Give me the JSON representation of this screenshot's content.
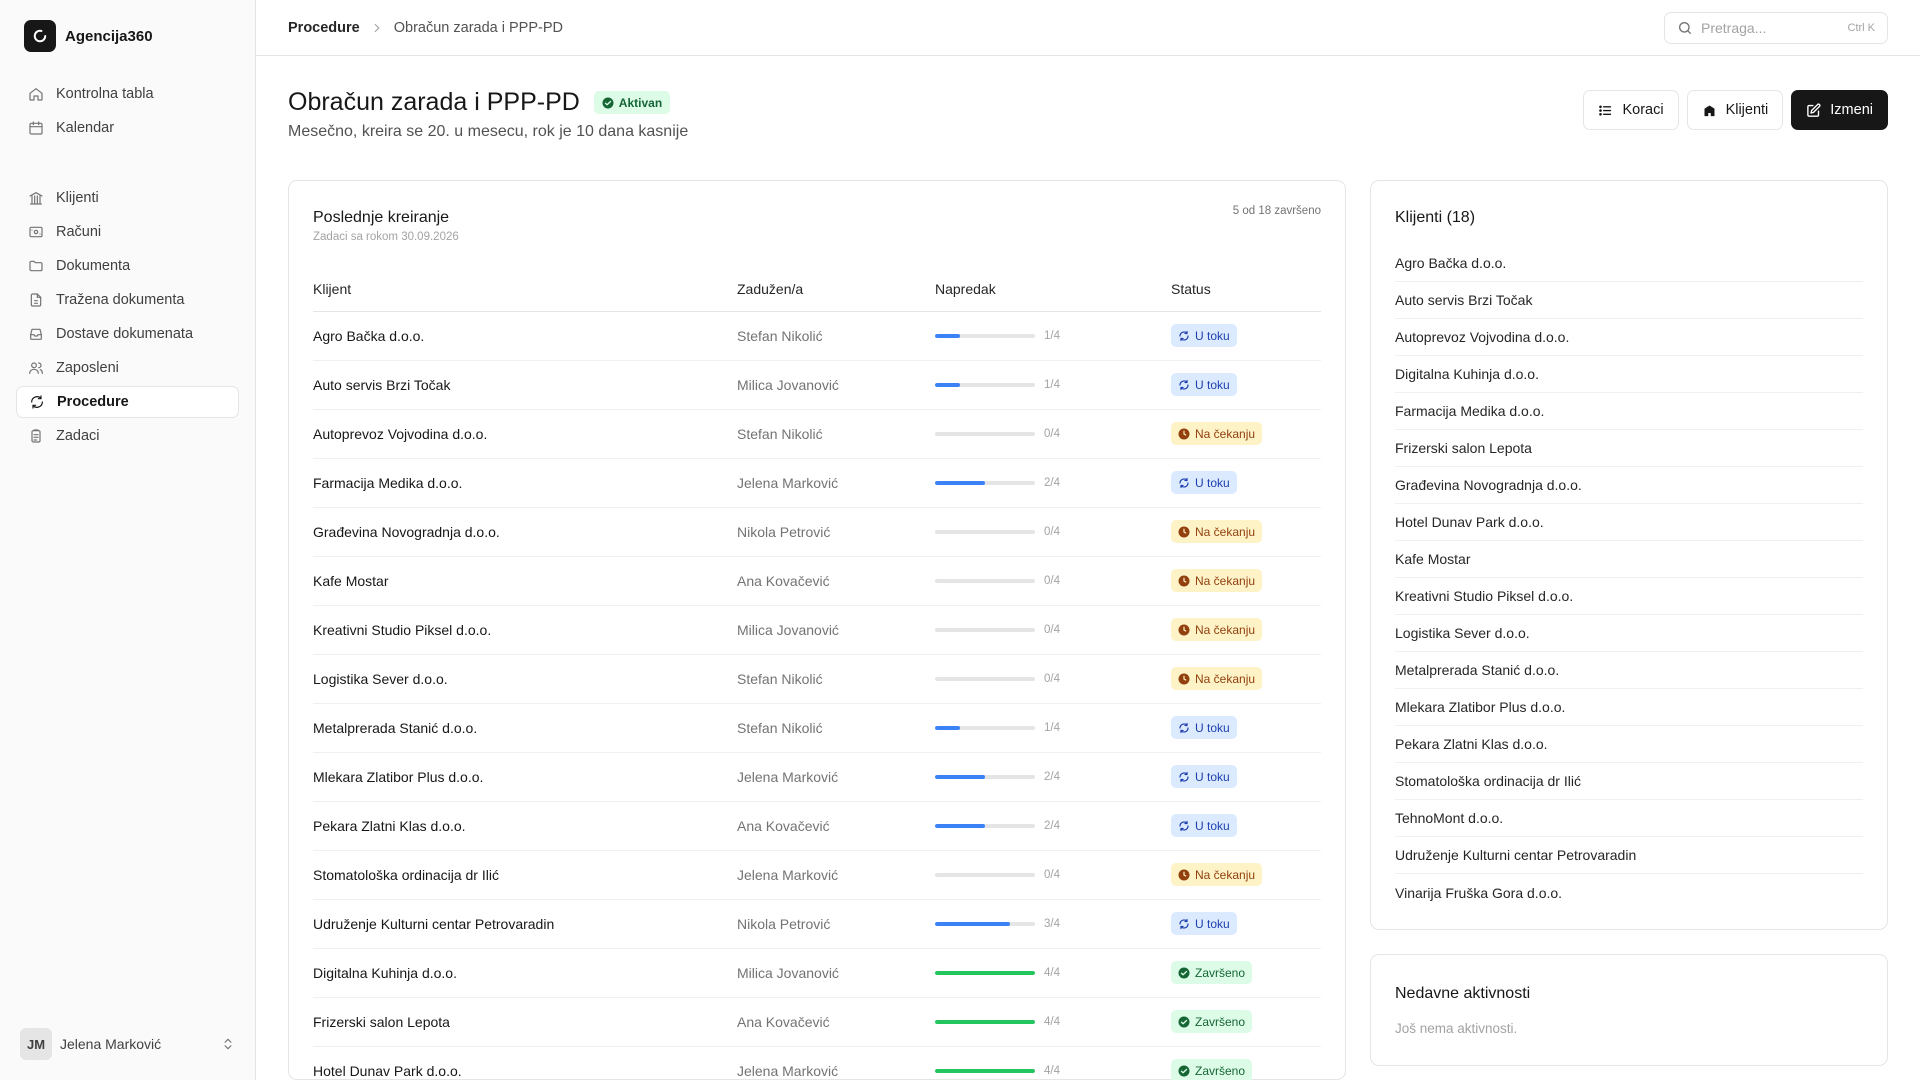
{
  "app": {
    "name": "Agencija360"
  },
  "nav": {
    "group1": [
      {
        "label": "Kontrolna tabla",
        "icon": "home-icon"
      },
      {
        "label": "Kalendar",
        "icon": "calendar-icon"
      }
    ],
    "group2": [
      {
        "label": "Klijenti",
        "icon": "building-icon"
      },
      {
        "label": "Računi",
        "icon": "receipt-icon"
      },
      {
        "label": "Dokumenta",
        "icon": "folder-icon"
      },
      {
        "label": "Tražena dokumenta",
        "icon": "file-request-icon"
      },
      {
        "label": "Dostave dokumenata",
        "icon": "inbox-icon"
      },
      {
        "label": "Zaposleni",
        "icon": "users-icon"
      },
      {
        "label": "Procedure",
        "icon": "refresh-icon",
        "active": true
      },
      {
        "label": "Zadaci",
        "icon": "clipboard-icon"
      }
    ]
  },
  "user": {
    "initials": "JM",
    "name": "Jelena Marković"
  },
  "breadcrumb": {
    "root": "Procedure",
    "current": "Obračun zarada i PPP-PD"
  },
  "search": {
    "placeholder": "Pretraga...",
    "shortcut": "Ctrl K"
  },
  "page": {
    "title": "Obračun zarada i PPP-PD",
    "status": "Aktivan",
    "subtitle": "Mesečno, kreira se 20. u mesecu, rok je 10 dana kasnije"
  },
  "actions": {
    "steps": "Koraci",
    "clients": "Klijenti",
    "edit": "Izmeni"
  },
  "tasks": {
    "title": "Poslednje kreiranje",
    "subtitle": "Zadaci sa rokom 30.09.2026",
    "summary": "5 od 18 završeno",
    "columns": {
      "client": "Klijent",
      "assignee": "Zadužen/a",
      "progress": "Napredak",
      "status": "Status"
    },
    "rows": [
      {
        "client": "Agro Bačka d.o.o.",
        "assignee": "Stefan Nikolić",
        "done": 1,
        "total": 4,
        "progress": "1/4",
        "status": "U toku",
        "kind": "progress"
      },
      {
        "client": "Auto servis Brzi Točak",
        "assignee": "Milica Jovanović",
        "done": 1,
        "total": 4,
        "progress": "1/4",
        "status": "U toku",
        "kind": "progress"
      },
      {
        "client": "Autoprevoz Vojvodina d.o.o.",
        "assignee": "Stefan Nikolić",
        "done": 0,
        "total": 4,
        "progress": "0/4",
        "status": "Na čekanju",
        "kind": "waiting"
      },
      {
        "client": "Farmacija Medika d.o.o.",
        "assignee": "Jelena Marković",
        "done": 2,
        "total": 4,
        "progress": "2/4",
        "status": "U toku",
        "kind": "progress"
      },
      {
        "client": "Građevina Novogradnja d.o.o.",
        "assignee": "Nikola Petrović",
        "done": 0,
        "total": 4,
        "progress": "0/4",
        "status": "Na čekanju",
        "kind": "waiting"
      },
      {
        "client": "Kafe Mostar",
        "assignee": "Ana Kovačević",
        "done": 0,
        "total": 4,
        "progress": "0/4",
        "status": "Na čekanju",
        "kind": "waiting"
      },
      {
        "client": "Kreativni Studio Piksel d.o.o.",
        "assignee": "Milica Jovanović",
        "done": 0,
        "total": 4,
        "progress": "0/4",
        "status": "Na čekanju",
        "kind": "waiting"
      },
      {
        "client": "Logistika Sever d.o.o.",
        "assignee": "Stefan Nikolić",
        "done": 0,
        "total": 4,
        "progress": "0/4",
        "status": "Na čekanju",
        "kind": "waiting"
      },
      {
        "client": "Metalprerada Stanić d.o.o.",
        "assignee": "Stefan Nikolić",
        "done": 1,
        "total": 4,
        "progress": "1/4",
        "status": "U toku",
        "kind": "progress"
      },
      {
        "client": "Mlekara Zlatibor Plus d.o.o.",
        "assignee": "Jelena Marković",
        "done": 2,
        "total": 4,
        "progress": "2/4",
        "status": "U toku",
        "kind": "progress"
      },
      {
        "client": "Pekara Zlatni Klas d.o.o.",
        "assignee": "Ana Kovačević",
        "done": 2,
        "total": 4,
        "progress": "2/4",
        "status": "U toku",
        "kind": "progress"
      },
      {
        "client": "Stomatološka ordinacija dr Ilić",
        "assignee": "Jelena Marković",
        "done": 0,
        "total": 4,
        "progress": "0/4",
        "status": "Na čekanju",
        "kind": "waiting"
      },
      {
        "client": "Udruženje Kulturni centar Petrovaradin",
        "assignee": "Nikola Petrović",
        "done": 3,
        "total": 4,
        "progress": "3/4",
        "status": "U toku",
        "kind": "progress"
      },
      {
        "client": "Digitalna Kuhinja d.o.o.",
        "assignee": "Milica Jovanović",
        "done": 4,
        "total": 4,
        "progress": "4/4",
        "status": "Završeno",
        "kind": "done"
      },
      {
        "client": "Frizerski salon Lepota",
        "assignee": "Ana Kovačević",
        "done": 4,
        "total": 4,
        "progress": "4/4",
        "status": "Završeno",
        "kind": "done"
      },
      {
        "client": "Hotel Dunav Park d.o.o.",
        "assignee": "Jelena Marković",
        "done": 4,
        "total": 4,
        "progress": "4/4",
        "status": "Završeno",
        "kind": "done"
      }
    ]
  },
  "clients": {
    "title": "Klijenti (18)",
    "items": [
      "Agro Bačka d.o.o.",
      "Auto servis Brzi Točak",
      "Autoprevoz Vojvodina d.o.o.",
      "Digitalna Kuhinja d.o.o.",
      "Farmacija Medika d.o.o.",
      "Frizerski salon Lepota",
      "Građevina Novogradnja d.o.o.",
      "Hotel Dunav Park d.o.o.",
      "Kafe Mostar",
      "Kreativni Studio Piksel d.o.o.",
      "Logistika Sever d.o.o.",
      "Metalprerada Stanić d.o.o.",
      "Mlekara Zlatibor Plus d.o.o.",
      "Pekara Zlatni Klas d.o.o.",
      "Stomatološka ordinacija dr Ilić",
      "TehnoMont d.o.o.",
      "Udruženje Kulturni centar Petrovaradin",
      "Vinarija Fruška Gora d.o.o."
    ]
  },
  "activity": {
    "title": "Nedavne aktivnosti",
    "empty": "Još nema aktivnosti."
  },
  "colors": {
    "progress": "#3b82f6",
    "done": "#22c55e",
    "accent": "#171717"
  }
}
